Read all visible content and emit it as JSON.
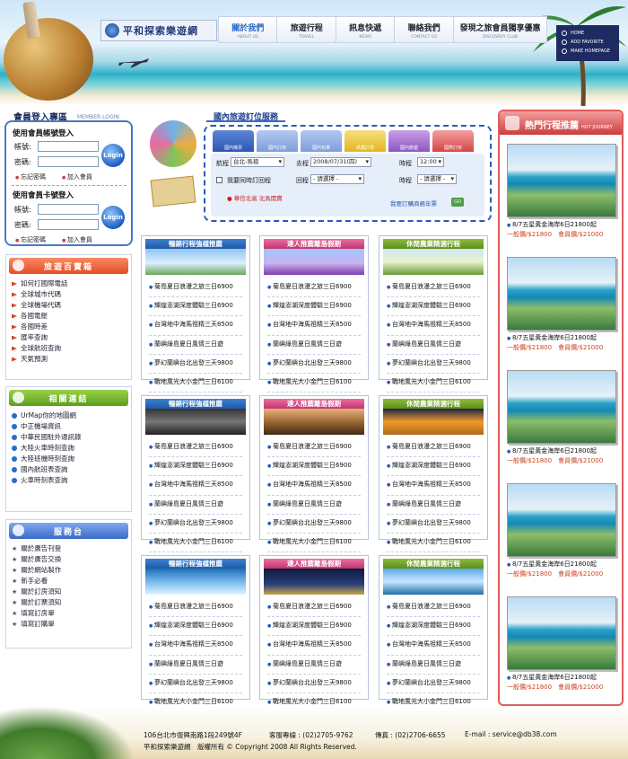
{
  "header": {
    "logo_text": "平和探索樂遊網",
    "nav": [
      {
        "zh": "關於我們",
        "en": "ABOUT US"
      },
      {
        "zh": "旅遊行程",
        "en": "TRAVEL"
      },
      {
        "zh": "訊息快遞",
        "en": "NEWS"
      },
      {
        "zh": "聯絡我們",
        "en": "CONTACT US"
      },
      {
        "zh": "發現之旅會員獨享優惠",
        "en": "DISCOVERY CLUB"
      }
    ],
    "quick_links": [
      "HOME",
      "ADD FAVORITE",
      "MAKE HOMEPAGE"
    ]
  },
  "login": {
    "title": "會員登入專區",
    "subtitle": "MEMBER LOGIN",
    "section1": "使用會員帳號登入",
    "section2": "使用會員卡號登入",
    "account_label": "帳號:",
    "password_label": "密碼:",
    "login_button": "Login",
    "forgot": "忘記密碼",
    "join": "加入會員"
  },
  "boxes": {
    "travel": {
      "title": "旅遊百寶箱",
      "items": [
        "如何打國際電話",
        "全球城市代碼",
        "全球機場代碼",
        "各國電壓",
        "各國時差",
        "匯率查詢",
        "全球航班查詢",
        "天氣預測"
      ]
    },
    "links": {
      "title": "相關連結",
      "items": [
        "UrMap你的地圖網",
        "中正機場資訊",
        "中華民國駐外通訊錄",
        "大陸火車時刻查詢",
        "大陸班機時刻查詢",
        "國內航班表查詢",
        "火車時刻表查詢"
      ]
    },
    "service": {
      "title": "服務台",
      "items": [
        "關於廣告刊登",
        "關於廣告交換",
        "關於網站製作",
        "新手必看",
        "關於訂房須知",
        "關於訂票須知",
        "填寫訂房單",
        "填寫訂購單"
      ]
    }
  },
  "search": {
    "title": "國內旅遊訂位服務",
    "tabs": [
      "國內機票",
      "國內訂房",
      "國內包車",
      "高鐵訂票",
      "國內旅遊",
      "國際訂房"
    ],
    "depart_label": "航程",
    "depart_value": "台北-馬祖",
    "date_label": "去程",
    "date_value": "2008/07/31(四)",
    "time_label": "時程",
    "time_value": "12:00",
    "return_check_label": "我要同時訂回程",
    "return_label": "回程",
    "return_value": "- 請選擇 -",
    "return_time_label": "時程",
    "return_time_value": "- 請選擇 -",
    "red_link": "● 華信北高 北馬開賣",
    "blue_link": "我要訂購商務年票",
    "go": "GO"
  },
  "cards": [
    {
      "title": "暢銷行程強檔推薦",
      "color": "blue"
    },
    {
      "title": "達人推薦離島假期",
      "color": "pink"
    },
    {
      "title": "休閒農業精選行程",
      "color": "green"
    },
    {
      "title": "暢銷行程強檔推薦",
      "color": "blue"
    },
    {
      "title": "達人推薦離島假期",
      "color": "pink"
    },
    {
      "title": "休閒農業精選行程",
      "color": "green"
    },
    {
      "title": "暢銷行程強檔推薦",
      "color": "blue"
    },
    {
      "title": "達人推薦離島假期",
      "color": "pink"
    },
    {
      "title": "休閒農業精選行程",
      "color": "green"
    }
  ],
  "card_items": [
    "菊島夏日浪漫之旅三日6900",
    "輝煌澎湖深度體驗三日6900",
    "台灣地中海馬祖精三天8500",
    "蘭嶼綠島夏日風情三日遊",
    "夢幻蘭嶼台北出發三天9800",
    "戰地風光大小金門三日6100"
  ],
  "hot": {
    "title": "熱門行程推薦",
    "subtitle": "HOT JOURNEY",
    "items": [
      {
        "name": "8/7五星黃金海岸6日21800起",
        "price": "一般價/$21800　會員價/$21000"
      },
      {
        "name": "8/7五星黃金海岸6日21800起",
        "price": "一般價/$21800　會員價/$21000"
      },
      {
        "name": "8/7五星黃金海岸6日21800起",
        "price": "一般價/$21800　會員價/$21000"
      },
      {
        "name": "8/7五星黃金海岸6日21800起",
        "price": "一般價/$21800　會員價/$21000"
      },
      {
        "name": "8/7五星黃金海岸6日21800起",
        "price": "一般價/$21800　會員價/$21000"
      }
    ]
  },
  "footer": {
    "address": "106台北市復興南路1段249號4F",
    "phone": "客服專線 : (02)2705-9762",
    "fax": "傳真 : (02)2706-6655",
    "email": "E-mail : service@db38.com",
    "copyright": "平和探索樂遊網　版權所有 © Copyright 2008 All Rights Reserved."
  },
  "colors": {
    "nav_active": "#2567c8",
    "accent_blue": "#2a5bb8",
    "hot_red": "#cc3d3d"
  }
}
